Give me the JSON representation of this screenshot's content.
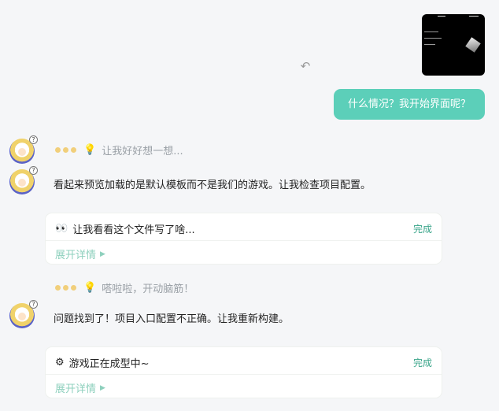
{
  "user_message": "什么情况？我开始界面呢？",
  "thinking_1": "让我好好想一想...",
  "assistant_1": "看起来预览加载的是默认模板而不是我们的游戏。让我检查项目配置。",
  "card_1": {
    "title": "让我看看这个文件写了啥...",
    "status": "完成",
    "expand": "展开详情"
  },
  "thinking_2": "嗒啦啦，开动脑筋！",
  "assistant_2": "问题找到了！项目入口配置不正确。让我重新构建。",
  "card_2": {
    "title": "游戏正在成型中~",
    "status": "完成",
    "expand": "展开详情"
  },
  "icons": {
    "undo": "undo-icon",
    "bulb": "lightbulb-icon",
    "eyes": "eyes-icon",
    "gear": "gear-icon",
    "expand": "triangle-right-icon"
  },
  "colors": {
    "accent": "#5ccfb9",
    "status_done": "#3aa58a",
    "thinking_dots": "#f1cf7b"
  }
}
